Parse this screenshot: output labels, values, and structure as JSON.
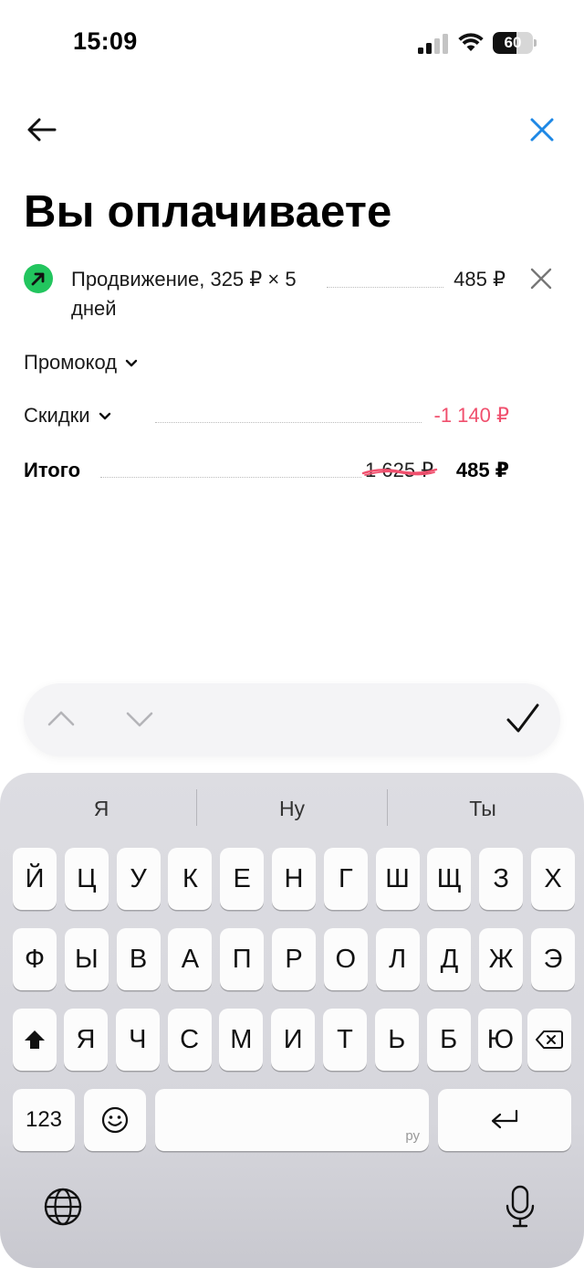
{
  "status": {
    "time": "15:09",
    "battery": "60",
    "battery_level": 0.6
  },
  "header": {
    "back_icon": "arrow-left-icon",
    "close_icon": "close-icon",
    "title": "Вы оплачиваете"
  },
  "order": {
    "item": {
      "icon": "arrow-up-right-icon",
      "name": "Продвижение, 325 ₽ × 5 дней",
      "price": "485 ₽",
      "remove_icon": "close-icon"
    },
    "promo_label": "Промокод",
    "discount_label": "Скидки",
    "discount_value": "-1 140 ₽",
    "total_label": "Итого",
    "total_old": "1 625 ₽",
    "total_new": "485 ₽",
    "accent_color": "#1e88e5",
    "discount_color": "#f0506e",
    "item_icon_color": "#22c55e"
  },
  "toolbar": {
    "prev_icon": "chevron-up-icon",
    "next_icon": "chevron-down-icon",
    "done_icon": "checkmark-icon"
  },
  "keyboard": {
    "suggestions": [
      "Я",
      "Ну",
      "Ты"
    ],
    "row1": [
      "Й",
      "Ц",
      "У",
      "К",
      "Е",
      "Н",
      "Г",
      "Ш",
      "Щ",
      "З",
      "Х"
    ],
    "row2": [
      "Ф",
      "Ы",
      "В",
      "А",
      "П",
      "Р",
      "О",
      "Л",
      "Д",
      "Ж",
      "Э"
    ],
    "row3": [
      "Я",
      "Ч",
      "С",
      "М",
      "И",
      "Т",
      "Ь",
      "Б",
      "Ю"
    ],
    "numbers_label": "123",
    "space_lang": "ру",
    "shift_icon": "shift-icon",
    "backspace_icon": "backspace-icon",
    "emoji_icon": "emoji-icon",
    "return_icon": "return-icon",
    "globe_icon": "globe-icon",
    "mic_icon": "microphone-icon"
  }
}
